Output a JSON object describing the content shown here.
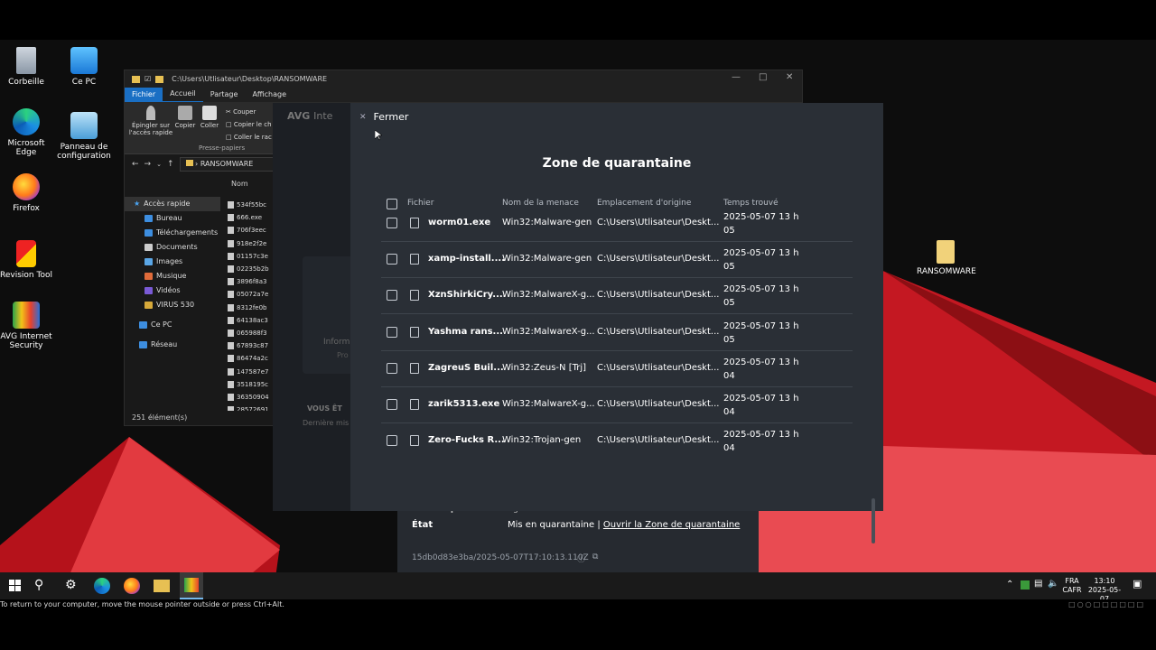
{
  "colors": {
    "avg_modal": "#2a2f36",
    "wallpaper_red": "#d9202b",
    "accent_blue": "#1a6fc4"
  },
  "desktop": {
    "icons": [
      {
        "label": "Corbeille",
        "icon": "recycle-bin-icon"
      },
      {
        "label": "Ce PC",
        "icon": "computer-icon"
      },
      {
        "label": "Microsoft Edge",
        "icon": "edge-icon"
      },
      {
        "label": "Panneau de configuration",
        "icon": "control-panel-icon"
      },
      {
        "label": "Firefox",
        "icon": "firefox-icon"
      },
      {
        "label": "Revision Tool",
        "icon": "revision-tool-icon"
      },
      {
        "label": "AVG Internet Security",
        "icon": "avg-icon"
      },
      {
        "label": "RANSOMWARE",
        "icon": "folder-icon"
      }
    ]
  },
  "explorer": {
    "path": "C:\\Users\\Utlisateur\\Desktop\\RANSOMWARE",
    "tabs": [
      "Fichier",
      "Accueil",
      "Partage",
      "Affichage"
    ],
    "ribbon": {
      "pin": "Épingler sur l'accès rapide",
      "copy": "Copier",
      "paste": "Coller",
      "cut": "Couper",
      "copy_path": "Copier le ch",
      "paste_shortcut": "Coller le rac",
      "group": "Presse-papiers"
    },
    "address": "RANSOMWARE",
    "column_name": "Nom",
    "nav": [
      "Accès rapide",
      "Bureau",
      "Téléchargements",
      "Documents",
      "Images",
      "Musique",
      "Vidéos",
      "VIRUS 530",
      "Ce PC",
      "Réseau"
    ],
    "files": [
      "534f55bc",
      "666.exe",
      "706f3eec",
      "918e2f2e",
      "01157c3e",
      "02235b2b",
      "3896f8a3",
      "05072a7e",
      "8312fe0b",
      "64138ac3",
      "065988f3",
      "67893c87",
      "86474a2c",
      "147587e7",
      "3518195c",
      "36350904",
      "28572691"
    ],
    "status": "251 élément(s)"
  },
  "avg_back": {
    "brand": "AVG",
    "brand_suffix": "Inte",
    "info_text": "Inform",
    "pro_text": "Pro",
    "vous_text": "VOUS ÊT",
    "derniere_text": "Dernière mis"
  },
  "avg_detail": {
    "detected_label": "Détecté par",
    "detected_value": "Agent des fichiers",
    "state_label": "État",
    "state_value": "Mis en quarantaine | ",
    "state_link": "Ouvrir la Zone de quarantaine",
    "id": "15db0d83e3ba/2025-05-07T17:10:13.110Z"
  },
  "quarantine": {
    "close_label": "Fermer",
    "title": "Zone de quarantaine",
    "headers": {
      "file": "Fichier",
      "threat": "Nom de la menace",
      "location": "Emplacement d'origine",
      "time": "Temps trouvé"
    },
    "rows": [
      {
        "file": "worm01.exe",
        "threat": "Win32:Malware-gen",
        "location": "C:\\Users\\Utlisateur\\Deskt...",
        "time": "2025-05-07 13 h 05"
      },
      {
        "file": "xamp-install....",
        "threat": "Win32:Malware-gen",
        "location": "C:\\Users\\Utlisateur\\Deskt...",
        "time": "2025-05-07 13 h 05"
      },
      {
        "file": "XznShirkiCry....",
        "threat": "Win32:MalwareX-g...",
        "location": "C:\\Users\\Utlisateur\\Deskt...",
        "time": "2025-05-07 13 h 05"
      },
      {
        "file": "Yashma rans...",
        "threat": "Win32:MalwareX-g...",
        "location": "C:\\Users\\Utlisateur\\Deskt...",
        "time": "2025-05-07 13 h 05"
      },
      {
        "file": "ZagreuS Buil...",
        "threat": "Win32:Zeus-N [Trj]",
        "location": "C:\\Users\\Utlisateur\\Deskt...",
        "time": "2025-05-07 13 h 04"
      },
      {
        "file": "zarik5313.exe",
        "threat": "Win32:MalwareX-g...",
        "location": "C:\\Users\\Utlisateur\\Deskt...",
        "time": "2025-05-07 13 h 04"
      },
      {
        "file": "Zero-Fucks R...",
        "threat": "Win32:Trojan-gen",
        "location": "C:\\Users\\Utlisateur\\Deskt...",
        "time": "2025-05-07 13 h 04"
      }
    ]
  },
  "taskbar": {
    "lang_top": "FRA",
    "lang_bottom": "CAFR",
    "time": "13:10",
    "date": "2025-05-07"
  },
  "hint": "To return to your computer, move the mouse pointer outside or press Ctrl+Alt."
}
